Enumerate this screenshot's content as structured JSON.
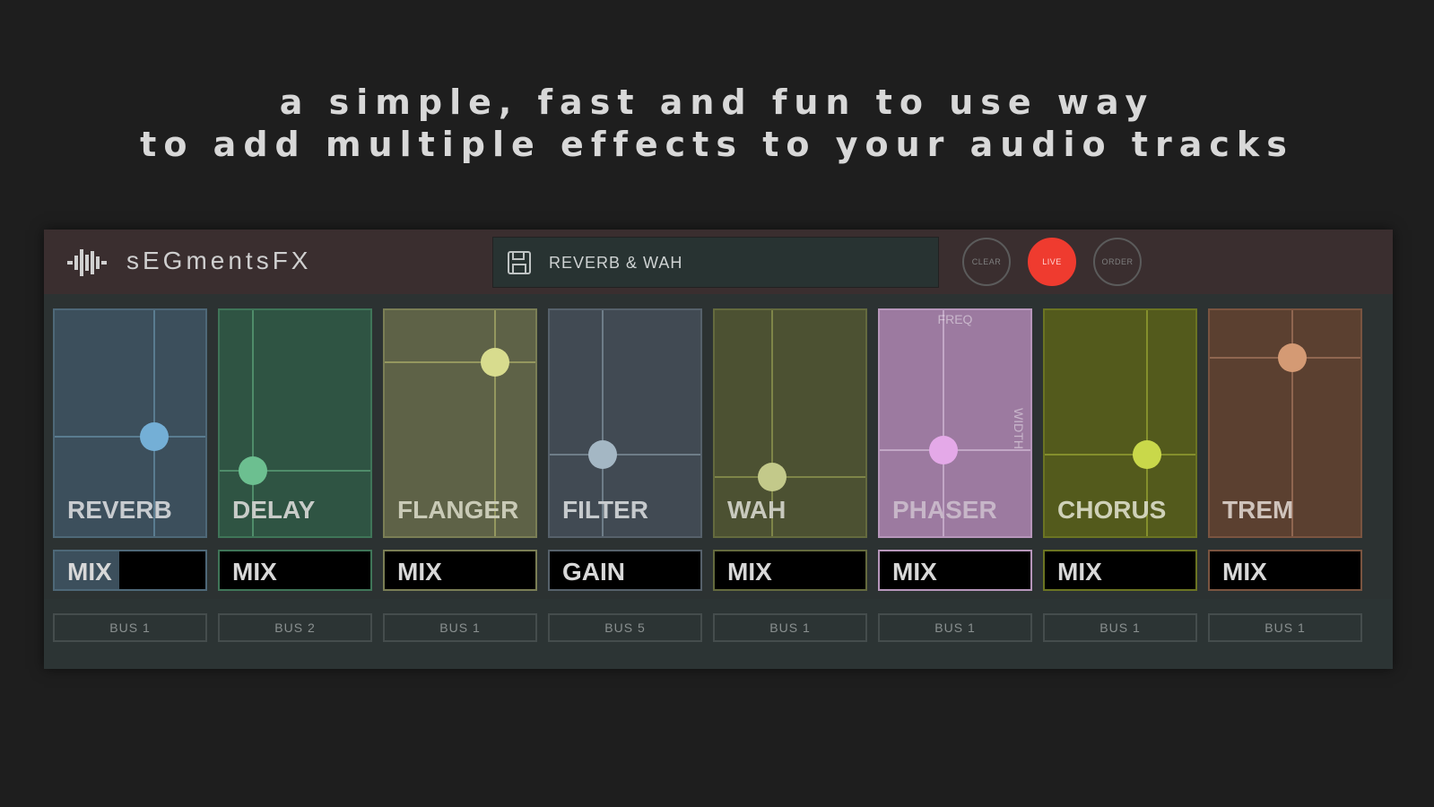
{
  "tagline": {
    "line1": "a simple, fast and fun to use way",
    "line2": "to add multiple effects to your audio tracks"
  },
  "app": {
    "logo_text": "sEGmentsFX",
    "preset": {
      "name": "REVERB & WAH",
      "icon": "save-icon"
    },
    "buttons": {
      "clear": "CLEAR",
      "live": "LIVE",
      "order": "ORDER"
    },
    "colors": {
      "live": "#ef3b2f",
      "topbar": "#3a2e2f"
    }
  },
  "effects": [
    {
      "name": "REVERB",
      "knob_x": 0.66,
      "knob_y": 0.56,
      "control": "MIX",
      "level": 0.43,
      "bus": "BUS 1",
      "bg": "#3c4f5c",
      "border": "#4e6878",
      "line": "#5a7c90",
      "knob": "#74afd6",
      "label_color": "#c8ccd0"
    },
    {
      "name": "DELAY",
      "knob_x": 0.22,
      "knob_y": 0.71,
      "control": "MIX",
      "level": 0,
      "bus": "BUS 2",
      "bg": "#2f5443",
      "border": "#3f7558",
      "line": "#4f8c6a",
      "knob": "#6cbf90",
      "label_color": "#c8ccc8"
    },
    {
      "name": "FLANGER",
      "knob_x": 0.73,
      "knob_y": 0.23,
      "control": "MIX",
      "level": 0,
      "bus": "BUS 1",
      "bg": "#5e6247",
      "border": "#7a7e55",
      "line": "#94975f",
      "knob": "#d8dc8e",
      "label_color": "#c9cab6"
    },
    {
      "name": "FILTER",
      "knob_x": 0.35,
      "knob_y": 0.64,
      "control": "GAIN",
      "level": 0,
      "bus": "BUS 5",
      "bg": "#414a53",
      "border": "#56616b",
      "line": "#6e7d88",
      "knob": "#a4b7c4",
      "label_color": "#c6cacd"
    },
    {
      "name": "WAH",
      "knob_x": 0.38,
      "knob_y": 0.74,
      "control": "MIX",
      "level": 0,
      "bus": "BUS 1",
      "bg": "#4c5132",
      "border": "#646a3e",
      "line": "#7e8548",
      "knob": "#c3c98a",
      "label_color": "#c8c9bd"
    },
    {
      "name": "PHASER",
      "knob_x": 0.42,
      "knob_y": 0.62,
      "control": "MIX",
      "level": 0,
      "bus": "BUS 1",
      "x_axis": "FREQ",
      "y_axis": "WIDTH",
      "bg": "#9c7aa0",
      "border": "#b796bb",
      "line": "#c2a7c6",
      "knob": "#e4a9e8",
      "label_color": "#c7b6c8"
    },
    {
      "name": "CHORUS",
      "knob_x": 0.68,
      "knob_y": 0.64,
      "control": "MIX",
      "level": 0,
      "bus": "BUS 1",
      "bg": "#535a1c",
      "border": "#6b7422",
      "line": "#848f2c",
      "knob": "#c9d84a",
      "label_color": "#cfd1b8"
    },
    {
      "name": "TREM",
      "knob_x": 0.55,
      "knob_y": 0.21,
      "control": "MIX",
      "level": 0,
      "bus": "BUS 1",
      "bg": "#5b4030",
      "border": "#7a5440",
      "line": "#8f6650",
      "knob": "#d49a74",
      "label_color": "#cfc3bb"
    }
  ]
}
